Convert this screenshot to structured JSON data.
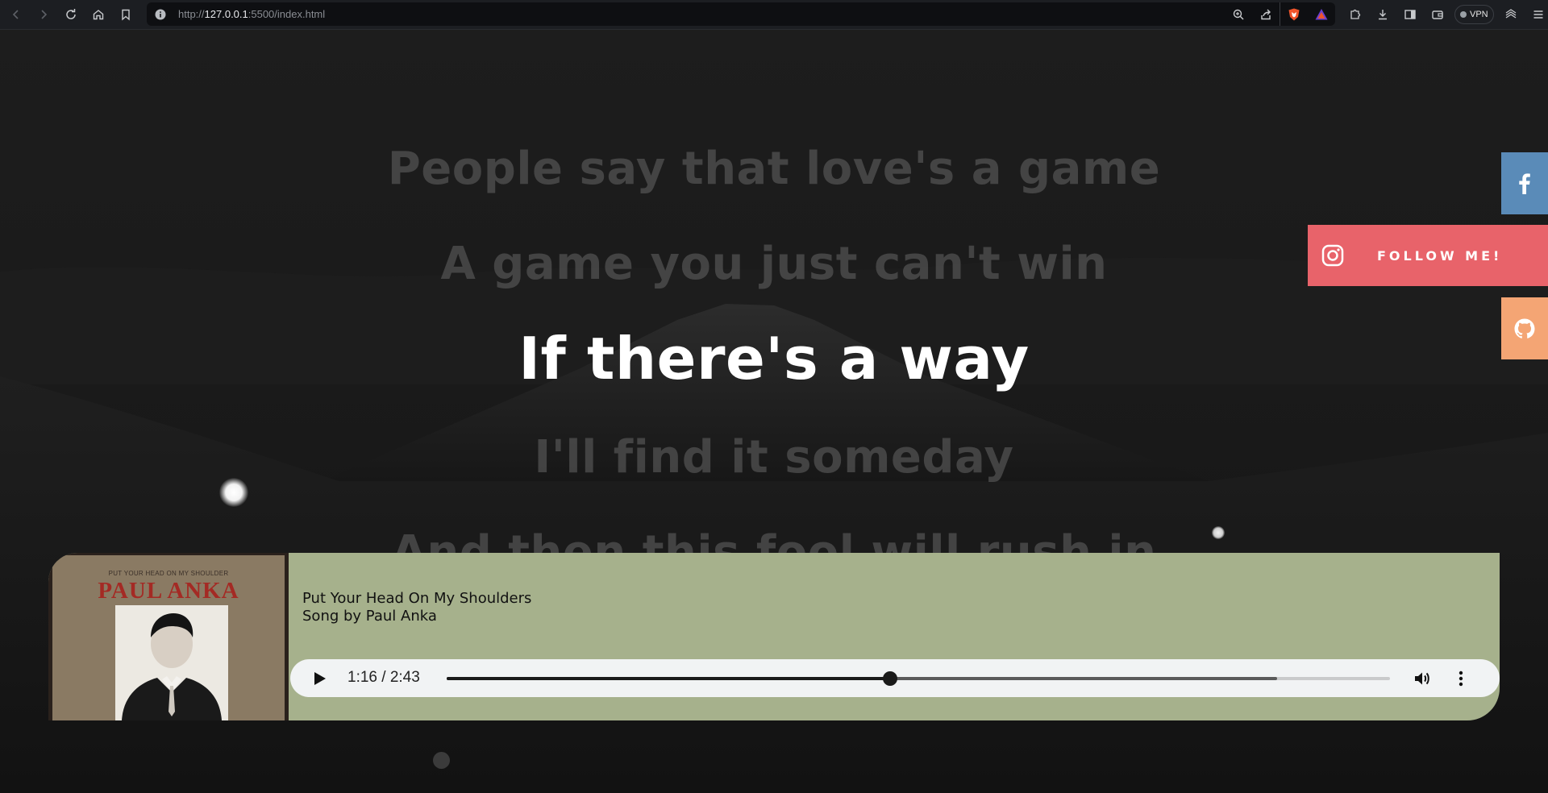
{
  "browser": {
    "url_prefix": "http://",
    "url_host": "127.0.0.1",
    "url_rest": ":5500/index.html",
    "vpn_label": "VPN",
    "icons": [
      "back-icon",
      "forward-icon",
      "reload-icon",
      "home-icon",
      "bookmark-icon",
      "site-info-icon",
      "zoom-icon",
      "share-icon",
      "brave-shields-icon",
      "brave-rewards-icon",
      "extensions-icon",
      "downloads-icon",
      "sidebar-icon",
      "wallet-icon",
      "leo-icon",
      "menu-icon"
    ]
  },
  "lyrics": {
    "lines": [
      "People say that love's a game",
      "A game you just can't win",
      "If there's a way",
      "I'll find it someday",
      "And then this fool will rush in"
    ],
    "active_index": 2
  },
  "social": {
    "facebook_icon": "facebook-icon",
    "instagram_label": "FOLLOW ME!",
    "instagram_icon": "instagram-icon",
    "github_icon": "github-icon",
    "colors": {
      "facebook": "#5a8bb8",
      "instagram": "#e8636a",
      "github": "#f4a574"
    }
  },
  "player": {
    "song_title": "Put Your Head On My Shoulders",
    "artist": "Song by Paul Anka",
    "cover_small_text": "PUT YOUR HEAD ON MY SHOULDER",
    "cover_big_text": "PAUL ANKA",
    "time_display": "1:16 / 2:43",
    "progress_fraction": 0.47,
    "buffered_fraction": 0.88,
    "background_color": "#a6b18c"
  }
}
